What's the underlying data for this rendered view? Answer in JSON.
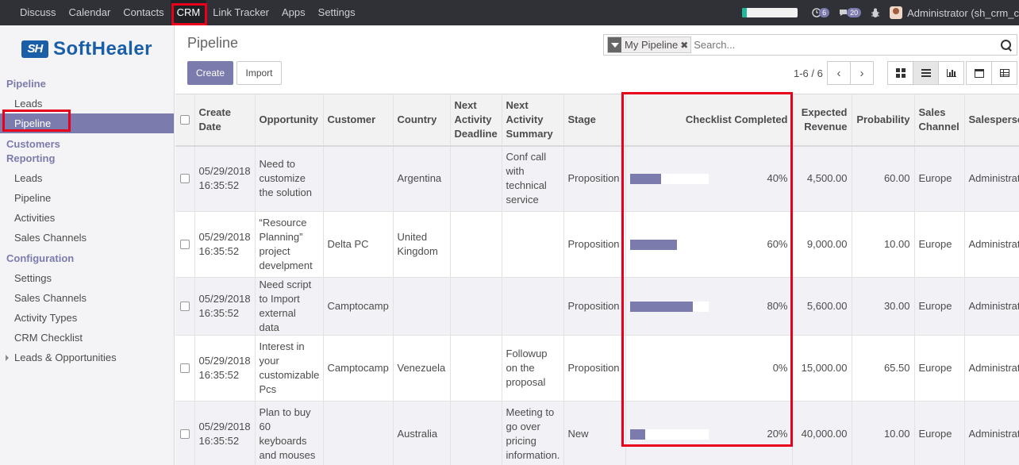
{
  "topbar": {
    "menu": [
      "Discuss",
      "Calendar",
      "Contacts",
      "CRM",
      "Link Tracker",
      "Apps",
      "Settings"
    ],
    "active_menu": "CRM",
    "activity_count": "6",
    "message_count": "20",
    "user_label": "Administrator (sh_crm_c"
  },
  "sidebar": {
    "logo_mark": "SH",
    "logo_text": "SoftHealer",
    "pipeline_head": "Pipeline",
    "pipeline_items": [
      "Leads",
      "Pipeline"
    ],
    "customers_head": "Customers",
    "reporting_head": "Reporting",
    "reporting_items": [
      "Leads",
      "Pipeline",
      "Activities",
      "Sales Channels"
    ],
    "config_head": "Configuration",
    "config_items": [
      "Settings",
      "Sales Channels",
      "Activity Types",
      "CRM Checklist"
    ],
    "leads_opps": "Leads & Opportunities"
  },
  "control": {
    "title": "Pipeline",
    "create_label": "Create",
    "import_label": "Import",
    "facet_label": "My Pipeline",
    "facet_remove": "✖",
    "search_placeholder": "Search...",
    "pager": "1-6 / 6",
    "prev": "‹",
    "next": "›"
  },
  "table": {
    "headers": [
      "Create Date",
      "Opportunity",
      "Customer",
      "Country",
      "Next Activity Deadline",
      "Next Activity Summary",
      "Stage",
      "Checklist Completed",
      "Expected Revenue",
      "Probability",
      "Sales Channel",
      "Salesperson"
    ],
    "rows": [
      {
        "date": "05/29/2018",
        "time": "16:35:52",
        "opportunity": "Need to customize the solution",
        "customer": "",
        "country": "Argentina",
        "deadline": "",
        "summary": "Conf call with technical service",
        "stage": "Proposition",
        "checklist": 40,
        "checklist_label": "40%",
        "revenue": "4,500.00",
        "probability": "60.00",
        "channel": "Europe",
        "salesperson": "Administrator"
      },
      {
        "date": "05/29/2018",
        "time": "16:35:52",
        "opportunity": "“Resource Planning” project develpment",
        "customer": "Delta PC",
        "country": "United Kingdom",
        "deadline": "",
        "summary": "",
        "stage": "Proposition",
        "checklist": 60,
        "checklist_label": "60%",
        "revenue": "9,000.00",
        "probability": "10.00",
        "channel": "Europe",
        "salesperson": "Administrator"
      },
      {
        "date": "05/29/2018",
        "time": "16:35:52",
        "opportunity": "Need script to Import external data",
        "customer": "Camptocamp",
        "country": "",
        "deadline": "",
        "summary": "",
        "stage": "Proposition",
        "checklist": 80,
        "checklist_label": "80%",
        "revenue": "5,600.00",
        "probability": "30.00",
        "channel": "Europe",
        "salesperson": "Administrator"
      },
      {
        "date": "05/29/2018",
        "time": "16:35:52",
        "opportunity": "Interest in your customizable Pcs",
        "customer": "Camptocamp",
        "country": "Venezuela",
        "deadline": "",
        "summary": "Followup on the proposal",
        "stage": "Proposition",
        "checklist": 0,
        "checklist_label": "0%",
        "revenue": "15,000.00",
        "probability": "65.50",
        "channel": "Europe",
        "salesperson": "Administrator"
      },
      {
        "date": "05/29/2018",
        "time": "16:35:52",
        "opportunity": "Plan to buy 60 keyboards and mouses",
        "customer": "",
        "country": "Australia",
        "deadline": "",
        "summary": "Meeting to go over pricing information.",
        "stage": "New",
        "checklist": 20,
        "checklist_label": "20%",
        "revenue": "40,000.00",
        "probability": "10.00",
        "channel": "Europe",
        "salesperson": "Administrator"
      }
    ]
  },
  "colors": {
    "accent": "#7c7bad",
    "highlight": "#e8001c",
    "topbar": "#2f3136"
  }
}
